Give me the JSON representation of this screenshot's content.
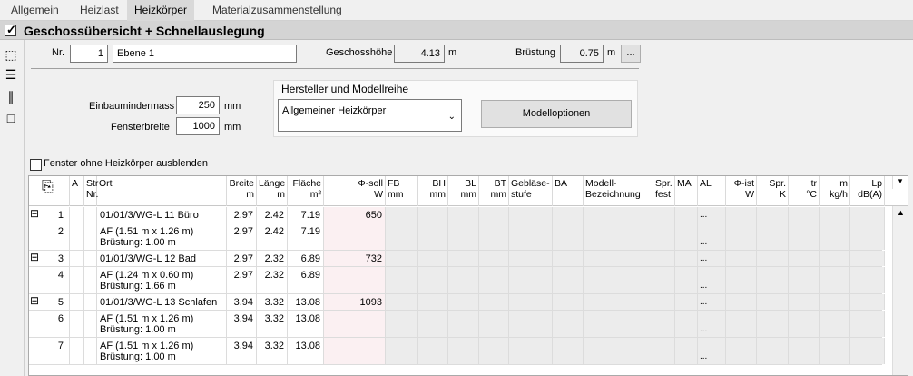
{
  "tabs": [
    {
      "label": "Allgemein"
    },
    {
      "label": "Heizlast"
    },
    {
      "label": "Heizkörper"
    },
    {
      "label": "Materialzusammenstellung"
    }
  ],
  "header": {
    "title": "Geschossübersicht + Schnellauslegung"
  },
  "floor": {
    "nr_label": "Nr.",
    "nr_value": "1",
    "name_value": "Ebene 1",
    "height_label": "Geschosshöhe",
    "height_value": "4.13",
    "height_unit": "m",
    "parapet_label": "Brüstung",
    "parapet_value": "0.75",
    "parapet_unit": "m",
    "more_label": "..."
  },
  "install": {
    "einbau_label": "Einbaumindermass",
    "einbau_value": "250",
    "einbau_unit": "mm",
    "fenster_label": "Fensterbreite",
    "fenster_value": "1000",
    "fenster_unit": "mm"
  },
  "manufacturer": {
    "title": "Hersteller und Modellreihe",
    "selected": "Allgemeiner Heizkörper",
    "options_button": "Modelloptionen"
  },
  "hide_checkbox_label": "Fenster ohne Heizkörper ausblenden",
  "grid": {
    "columns": [
      {
        "h1": "A",
        "h2": ""
      },
      {
        "h1": "Str",
        "h2": "Nr."
      },
      {
        "h1": "Ort",
        "h2": ""
      },
      {
        "h1": "Breite",
        "h2": "m"
      },
      {
        "h1": "Länge",
        "h2": "m"
      },
      {
        "h1": "Fläche",
        "h2": "m²"
      },
      {
        "h1": "Φ-soll",
        "h2": "W"
      },
      {
        "h1": "FB",
        "h2": "mm"
      },
      {
        "h1": "BH",
        "h2": "mm"
      },
      {
        "h1": "BL",
        "h2": "mm"
      },
      {
        "h1": "BT",
        "h2": "mm"
      },
      {
        "h1": "Gebläse-",
        "h2": "stufe"
      },
      {
        "h1": "BA",
        "h2": ""
      },
      {
        "h1": "Modell-",
        "h2": "Bezeichnung"
      },
      {
        "h1": "Spr.",
        "h2": "fest"
      },
      {
        "h1": "MA",
        "h2": ""
      },
      {
        "h1": "AL",
        "h2": ""
      },
      {
        "h1": "Φ-ist",
        "h2": "W"
      },
      {
        "h1": "Spr.",
        "h2": "K"
      },
      {
        "h1": "tr",
        "h2": "°C"
      },
      {
        "h1": "m",
        "h2": "kg/h"
      },
      {
        "h1": "Lp",
        "h2": "dB(A)"
      }
    ],
    "rows": [
      {
        "num": "1",
        "ort": "01/01/3/WG-L 11 Büro",
        "ort2": "",
        "breite": "2.97",
        "laenge": "2.42",
        "flaeche": "7.19",
        "phi": "650",
        "group": true
      },
      {
        "num": "2",
        "ort": "AF (1.51 m x 1.26 m)",
        "ort2": "Brüstung: 1.00 m",
        "breite": "2.97",
        "laenge": "2.42",
        "flaeche": "7.19",
        "phi": "",
        "group": false
      },
      {
        "num": "3",
        "ort": "01/01/3/WG-L 12 Bad",
        "ort2": "",
        "breite": "2.97",
        "laenge": "2.32",
        "flaeche": "6.89",
        "phi": "732",
        "group": true
      },
      {
        "num": "4",
        "ort": "AF (1.24 m x 0.60 m)",
        "ort2": "Brüstung: 1.66 m",
        "breite": "2.97",
        "laenge": "2.32",
        "flaeche": "6.89",
        "phi": "",
        "group": false
      },
      {
        "num": "5",
        "ort": "01/01/3/WG-L 13 Schlafen",
        "ort2": "",
        "breite": "3.94",
        "laenge": "3.32",
        "flaeche": "13.08",
        "phi": "1093",
        "group": true
      },
      {
        "num": "6",
        "ort": "AF (1.51 m x 1.26 m)",
        "ort2": "Brüstung: 1.00 m",
        "breite": "3.94",
        "laenge": "3.32",
        "flaeche": "13.08",
        "phi": "",
        "group": false
      },
      {
        "num": "7",
        "ort": "AF (1.51 m x 1.26 m)",
        "ort2": "Brüstung: 1.00 m",
        "breite": "3.94",
        "laenge": "3.32",
        "flaeche": "13.08",
        "phi": "",
        "group": false
      }
    ],
    "al_marker": "..."
  }
}
